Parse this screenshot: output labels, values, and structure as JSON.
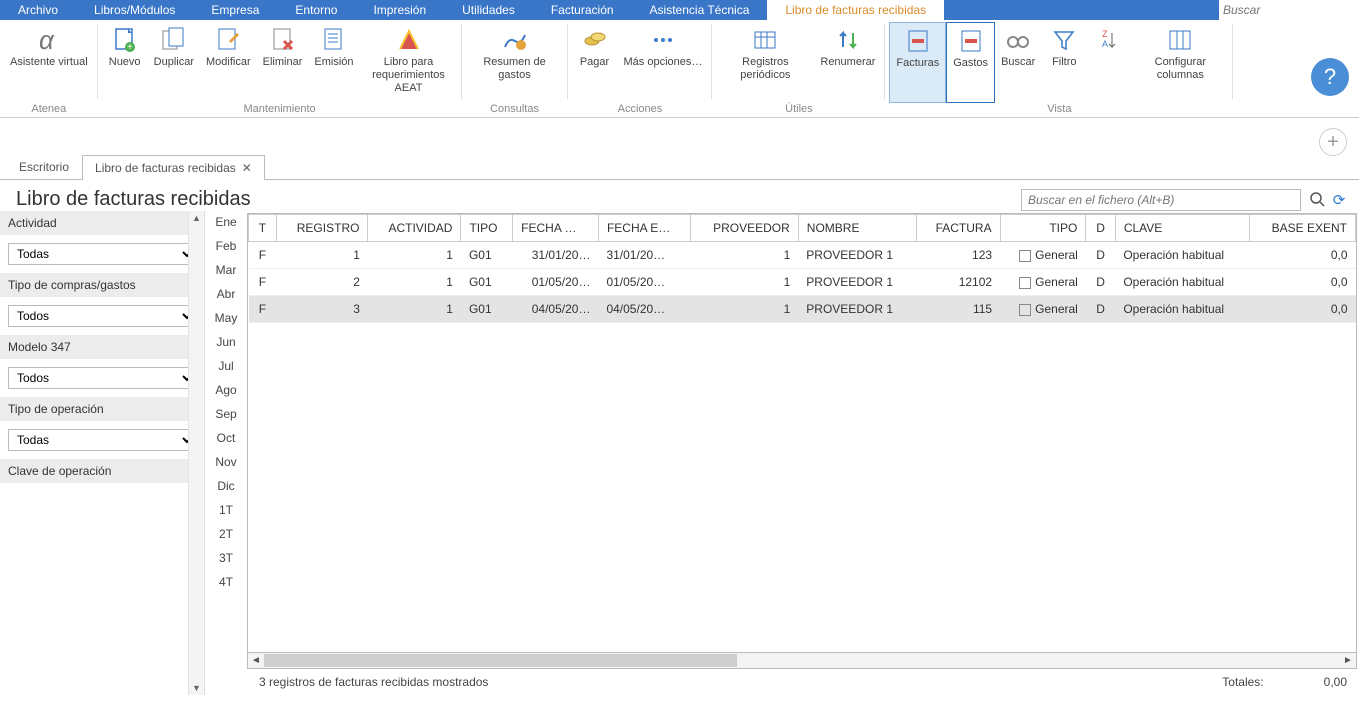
{
  "menu": {
    "items": [
      "Archivo",
      "Libros/Módulos",
      "Empresa",
      "Entorno",
      "Impresión",
      "Utilidades",
      "Facturación",
      "Asistencia Técnica",
      "Libro de facturas recibidas"
    ],
    "active_index": 8,
    "search_placeholder": "Buscar"
  },
  "ribbon": {
    "groups": [
      {
        "title": "Atenea",
        "items": [
          {
            "id": "asistente",
            "label": "Asistente virtual"
          }
        ]
      },
      {
        "title": "Mantenimiento",
        "items": [
          {
            "id": "nuevo",
            "label": "Nuevo"
          },
          {
            "id": "duplicar",
            "label": "Duplicar"
          },
          {
            "id": "modificar",
            "label": "Modificar"
          },
          {
            "id": "eliminar",
            "label": "Eliminar"
          },
          {
            "id": "emision",
            "label": "Emisión"
          },
          {
            "id": "libro_aeat",
            "label": "Libro para requerimientos AEAT"
          }
        ]
      },
      {
        "title": "Consultas",
        "items": [
          {
            "id": "resumen",
            "label": "Resumen de gastos"
          }
        ]
      },
      {
        "title": "Acciones",
        "items": [
          {
            "id": "pagar",
            "label": "Pagar"
          },
          {
            "id": "mas",
            "label": "Más opciones…"
          }
        ]
      },
      {
        "title": "Útiles",
        "items": [
          {
            "id": "registros",
            "label": "Registros periódicos"
          },
          {
            "id": "renumerar",
            "label": "Renumerar"
          }
        ]
      },
      {
        "title": "Vista",
        "items": [
          {
            "id": "facturas",
            "label": "Facturas",
            "selected": true
          },
          {
            "id": "gastos",
            "label": "Gastos",
            "hi": true
          },
          {
            "id": "buscar",
            "label": "Buscar"
          },
          {
            "id": "filtro",
            "label": "Filtro"
          },
          {
            "id": "sort",
            "label": ""
          },
          {
            "id": "columnas",
            "label": "Configurar columnas"
          }
        ]
      }
    ]
  },
  "tabs": {
    "items": [
      {
        "label": "Escritorio",
        "closable": false
      },
      {
        "label": "Libro de facturas recibidas",
        "closable": true,
        "active": true
      }
    ]
  },
  "page": {
    "title": "Libro de facturas recibidas",
    "file_search_placeholder": "Buscar en el fichero (Alt+B)"
  },
  "filters": {
    "actividad": {
      "label": "Actividad",
      "value": "Todas"
    },
    "tipo_compras": {
      "label": "Tipo de compras/gastos",
      "value": "Todos"
    },
    "modelo347": {
      "label": "Modelo 347",
      "value": "Todos"
    },
    "tipo_operacion": {
      "label": "Tipo de operación",
      "value": "Todas"
    },
    "clave_operacion": {
      "label": "Clave de operación"
    }
  },
  "months": [
    "Ene",
    "Feb",
    "Mar",
    "Abr",
    "May",
    "Jun",
    "Jul",
    "Ago",
    "Sep",
    "Oct",
    "Nov",
    "Dic",
    "1T",
    "2T",
    "3T",
    "4T"
  ],
  "grid": {
    "columns": [
      "T",
      "REGISTRO",
      "ACTIVIDAD",
      "TIPO",
      "FECHA …",
      "FECHA E…",
      "PROVEEDOR",
      "NOMBRE",
      "FACTURA",
      "TIPO",
      "D",
      "CLAVE",
      "BASE EXENT"
    ],
    "rows": [
      {
        "t": "F",
        "registro": "1",
        "actividad": "1",
        "tipo": "G01",
        "fecha": "31/01/20…",
        "fechae": "31/01/20…",
        "proveedor": "1",
        "nombre": "PROVEEDOR 1",
        "factura": "123",
        "tipo2": "General",
        "d": "D",
        "clave": "Operación habitual",
        "base": "0,0"
      },
      {
        "t": "F",
        "registro": "2",
        "actividad": "1",
        "tipo": "G01",
        "fecha": "01/05/20…",
        "fechae": "01/05/20…",
        "proveedor": "1",
        "nombre": "PROVEEDOR 1",
        "factura": "12102",
        "tipo2": "General",
        "d": "D",
        "clave": "Operación habitual",
        "base": "0,0"
      },
      {
        "t": "F",
        "registro": "3",
        "actividad": "1",
        "tipo": "G01",
        "fecha": "04/05/20…",
        "fechae": "04/05/20…",
        "proveedor": "1",
        "nombre": "PROVEEDOR 1",
        "factura": "115",
        "tipo2": "General",
        "d": "D",
        "clave": "Operación habitual",
        "base": "0,0",
        "selected": true
      }
    ]
  },
  "status": {
    "text": "3 registros de facturas recibidas mostrados",
    "totals_label": "Totales:",
    "totals_value": "0,00"
  }
}
